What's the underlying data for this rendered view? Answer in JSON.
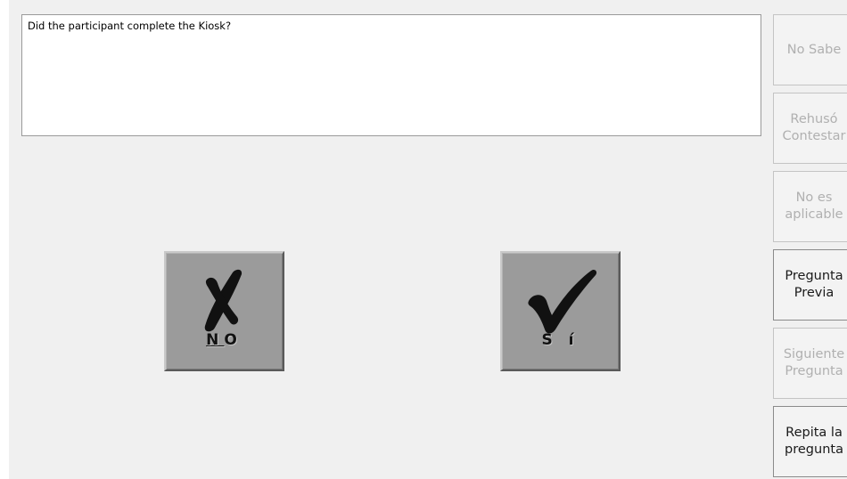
{
  "question": {
    "text": "Did the participant complete the Kiosk?"
  },
  "answer_buttons": [
    {
      "label_first": "N",
      "label_rest": "O",
      "icon": "x-mark-icon"
    },
    {
      "label": "S í",
      "icon": "checkmark-icon"
    }
  ],
  "side_buttons": [
    {
      "label": "No Sabe",
      "enabled": false
    },
    {
      "label": "Rehusó\nContestar",
      "enabled": false
    },
    {
      "label": "No es\naplicable",
      "enabled": false
    },
    {
      "label": "Pregunta\nPrevia",
      "enabled": true
    },
    {
      "label": "Siguiente\nPregunta",
      "enabled": false
    },
    {
      "label": "Repita la\npregunta",
      "enabled": true
    }
  ],
  "colors": {
    "background": "#f0f0f0",
    "big_button_face": "#9b9b9b",
    "disabled_text": "#b0b0b0",
    "enabled_text": "#1a1a1a"
  }
}
